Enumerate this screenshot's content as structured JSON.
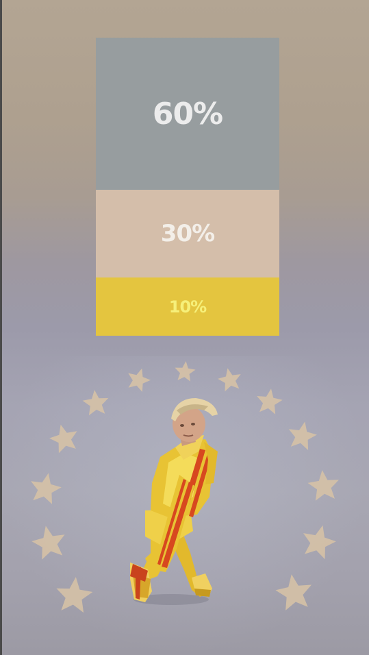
{
  "palette": {
    "swatches": [
      {
        "label": "60%",
        "value": 60,
        "color": "#979d9f"
      },
      {
        "label": "30%",
        "value": 30,
        "color": "#d4beaa"
      },
      {
        "label": "10%",
        "value": 10,
        "color": "#e4c53f"
      }
    ]
  },
  "scene": {
    "background_color": "#a5a4b3",
    "star_color": "#d8c3a6",
    "star_count": 18,
    "figure_outfit_color": "#e8c334",
    "figure_stripe_color": "#d7481f"
  }
}
